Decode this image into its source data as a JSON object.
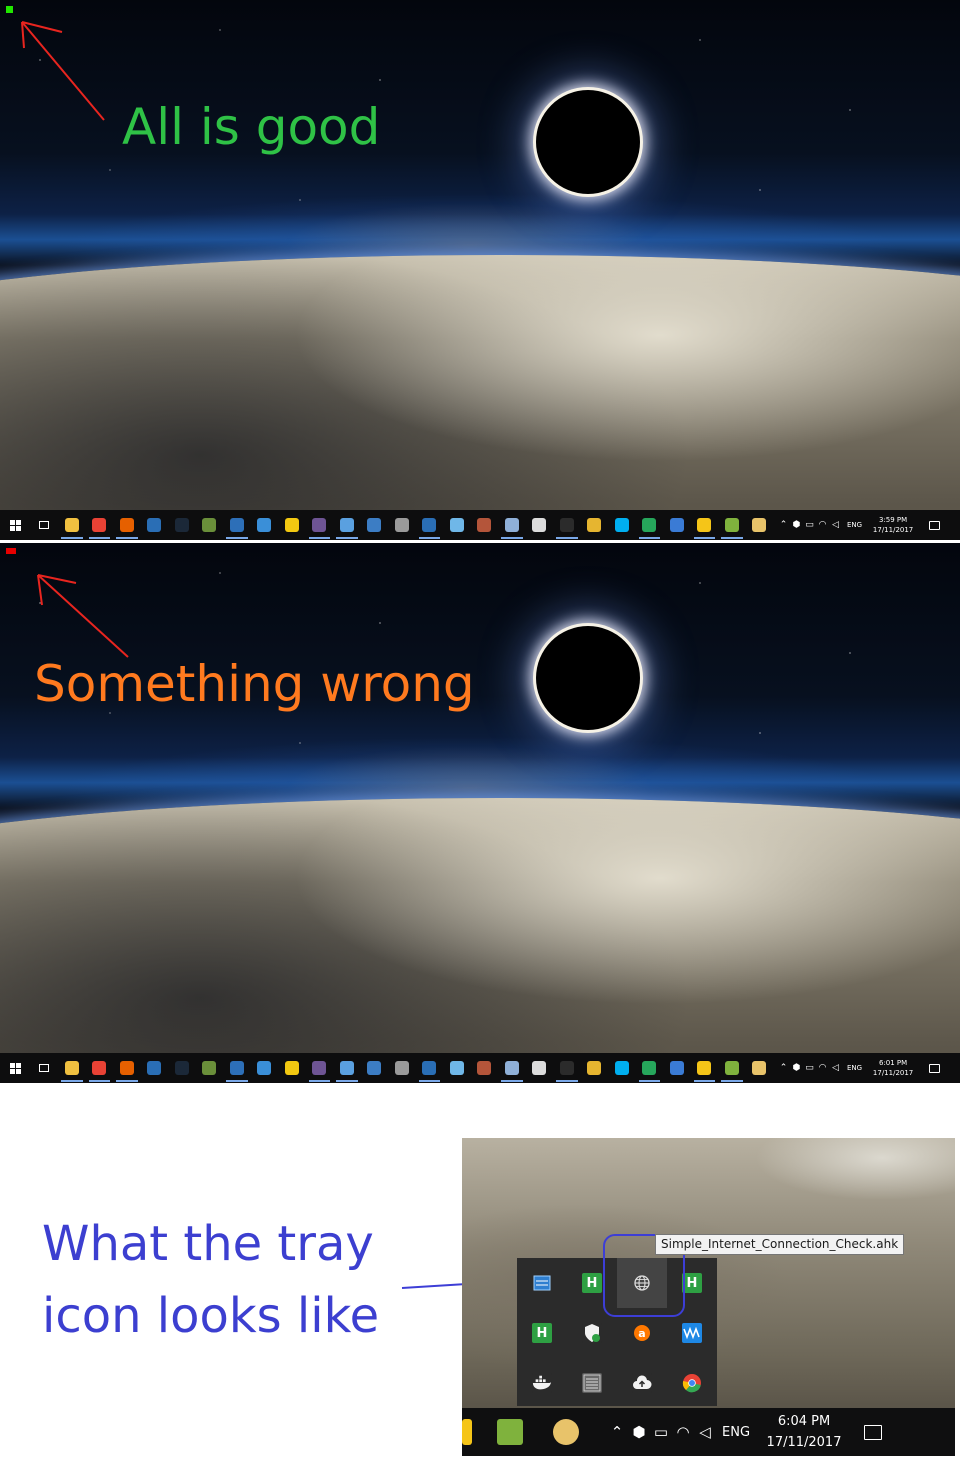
{
  "top_panel": {
    "caption": "All is good",
    "status_color": "#21e600",
    "clock": {
      "time": "3:59 PM",
      "date": "17/11/2017"
    },
    "lang": "ENG"
  },
  "bottom_panel": {
    "caption": "Something wrong",
    "status_color": "#e60000",
    "clock": {
      "time": "6:01 PM",
      "date": "17/11/2017"
    },
    "lang": "ENG"
  },
  "colors": {
    "good": "#2fc246",
    "wrong": "#ff7a1f",
    "annotation": "#3c3fd0",
    "arrow": "#e8251f"
  },
  "taskbar_apps": [
    {
      "icon": "file-explorer-icon",
      "color": "#f0c040"
    },
    {
      "icon": "chrome-icon",
      "color": "#e94235"
    },
    {
      "icon": "firefox-icon",
      "color": "#e66000"
    },
    {
      "icon": "monitor-app-icon",
      "color": "#2a6eb5"
    },
    {
      "icon": "steam-icon",
      "color": "#1b2838"
    },
    {
      "icon": "minecraft-icon",
      "color": "#6a8f3a"
    },
    {
      "icon": "powershell-icon",
      "color": "#2d6fb8"
    },
    {
      "icon": "snowflake-app-icon",
      "color": "#3a8fd8"
    },
    {
      "icon": "power-bi-icon",
      "color": "#f2c811"
    },
    {
      "icon": "github-icon",
      "color": "#6e5494"
    },
    {
      "icon": "cube-app-icon",
      "color": "#5aa0e0"
    },
    {
      "icon": "virtualbox-icon",
      "color": "#3c7dc4"
    },
    {
      "icon": "database-icon",
      "color": "#9a9a9a"
    },
    {
      "icon": "r-studio-icon",
      "color": "#2a6eb5"
    },
    {
      "icon": "notes-app-icon",
      "color": "#6fb7e8"
    },
    {
      "icon": "photo-app-icon",
      "color": "#b4553a"
    },
    {
      "icon": "document-app-icon",
      "color": "#8fb0d8"
    },
    {
      "icon": "disc-app-icon",
      "color": "#dcdcdc"
    },
    {
      "icon": "terminal-icon",
      "color": "#2b2b2b"
    },
    {
      "icon": "file-manager-icon",
      "color": "#e6b530"
    },
    {
      "icon": "skype-icon",
      "color": "#00aff0"
    },
    {
      "icon": "eye-app-icon",
      "color": "#26a65b"
    },
    {
      "icon": "network-app-icon",
      "color": "#3a7bd5"
    },
    {
      "icon": "file-key-icon",
      "color": "#f5c518"
    },
    {
      "icon": "notepad-plus-icon",
      "color": "#7fb23d"
    },
    {
      "icon": "paint-app-icon",
      "color": "#e8c36a"
    }
  ],
  "tray_glyphs": [
    "chevron-up-icon",
    "dropbox-icon",
    "battery-icon",
    "wifi-icon",
    "volume-icon"
  ],
  "inset": {
    "tooltip": "Simple_Internet_Connection_Check.ahk",
    "clock": {
      "time": "6:04 PM",
      "date": "17/11/2017"
    },
    "lang": "ENG",
    "overflow_icons": [
      {
        "icon": "monitor-app-icon",
        "color": "#2f7fd0",
        "glyph": ""
      },
      {
        "icon": "hitman-h-icon",
        "color": "#2ea043",
        "glyph": "H"
      },
      {
        "icon": "globe-icon",
        "color": "#444444",
        "glyph": ""
      },
      {
        "icon": "hitman-h-icon",
        "color": "#2ea043",
        "glyph": "H"
      },
      {
        "icon": "hitman-h-icon",
        "color": "#2ea043",
        "glyph": "H"
      },
      {
        "icon": "defender-shield-icon",
        "color": "#2b2b2b",
        "glyph": ""
      },
      {
        "icon": "avast-icon",
        "color": "#ff7800",
        "glyph": ""
      },
      {
        "icon": "waves-app-icon",
        "color": "#1e88e5",
        "glyph": ""
      },
      {
        "icon": "docker-icon",
        "color": "#2b2b2b",
        "glyph": ""
      },
      {
        "icon": "list-app-icon",
        "color": "#5a5a5a",
        "glyph": ""
      },
      {
        "icon": "cloud-upload-icon",
        "color": "#2b2b2b",
        "glyph": ""
      },
      {
        "icon": "chrome-icon",
        "color": "#e94235",
        "glyph": ""
      }
    ]
  },
  "annotation": {
    "line1": "What the tray",
    "line2": "icon looks like"
  }
}
